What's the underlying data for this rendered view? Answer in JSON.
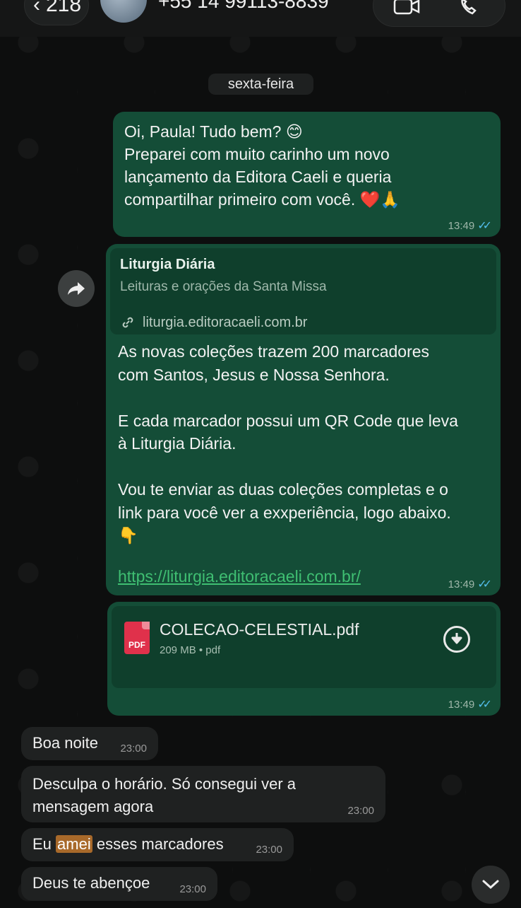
{
  "header": {
    "back_count": "218",
    "contact_name": "+55 14 99113-8839"
  },
  "date_chip": "sexta-feira",
  "colors": {
    "outgoing_bubble": "#144d37",
    "incoming_bubble": "#1f2121",
    "link": "#3fbf72",
    "read_ticks": "#53bdeb"
  },
  "messages": {
    "m1": {
      "lines": [
        "Oi, Paula! Tudo bem? 😊",
        "Preparei com muito carinho um novo",
        "lançamento da Editora Caeli e queria",
        "compartilhar primeiro com você. ❤️🙏"
      ],
      "time": "13:49",
      "ticks": "✓✓"
    },
    "m2": {
      "preview_title": "Liturgia Diária",
      "preview_subtitle": "Leituras e orações da Santa Missa",
      "preview_domain": "liturgia.editoracaeli.com.br",
      "body": [
        "As novas coleções trazem 200 marcadores",
        "com Santos, Jesus e Nossa Senhora.",
        "",
        "E cada marcador possui um QR Code que leva",
        "à Liturgia Diária.",
        "",
        "Vou te enviar as duas coleções completas e o",
        "link para você ver a exxperiência, logo abaixo.",
        "👇"
      ],
      "link": "https://liturgia.editoracaeli.com.br/",
      "time": "13:49",
      "ticks": "✓✓"
    },
    "m3": {
      "icon_label": "PDF",
      "file_name": "COLECAO-CELESTIAL.pdf",
      "file_meta": "209 MB • pdf",
      "time": "13:49",
      "ticks": "✓✓"
    },
    "m4": {
      "text": "Boa noite",
      "time": "23:00"
    },
    "m5": {
      "line1": "Desculpa o horário. Só consegui ver a",
      "line2": "mensagem agora",
      "time": "23:00"
    },
    "m6": {
      "before": "Eu ",
      "highlight": "amei",
      "after": " esses marcadores",
      "time": "23:00"
    },
    "m7": {
      "text": "Deus te abençoe",
      "time": "23:00"
    }
  }
}
